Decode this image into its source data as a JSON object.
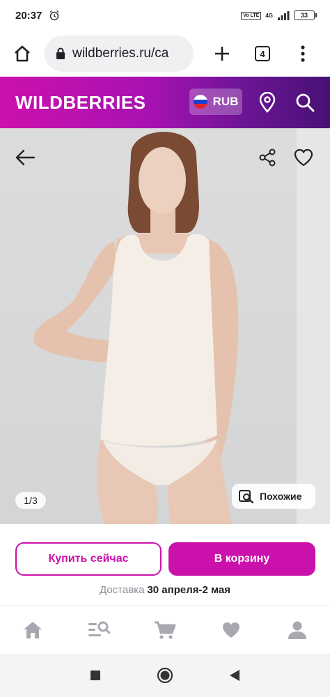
{
  "status_bar": {
    "time": "20:37",
    "network_badge": "Vo LTE",
    "network_type": "4G",
    "battery": "33"
  },
  "browser": {
    "url": "wildberries.ru/ca",
    "tabs_count": "4"
  },
  "header": {
    "logo": "WILDBERRIES",
    "currency": "RUB"
  },
  "gallery": {
    "counter": "1/3",
    "similar_label": "Похожие"
  },
  "actions": {
    "buy_now_label": "Купить сейчас",
    "add_to_cart_label": "В корзину",
    "delivery_label": "Доставка",
    "delivery_date": "30 апреля-2 мая"
  },
  "colors": {
    "brand": "#cb11ab",
    "brand_dark": "#481173",
    "icon_gray": "#a8a8b0"
  },
  "bottom_nav": {
    "items": [
      {
        "icon": "home-icon"
      },
      {
        "icon": "catalog-search-icon"
      },
      {
        "icon": "cart-icon"
      },
      {
        "icon": "heart-icon"
      },
      {
        "icon": "profile-icon"
      }
    ]
  }
}
